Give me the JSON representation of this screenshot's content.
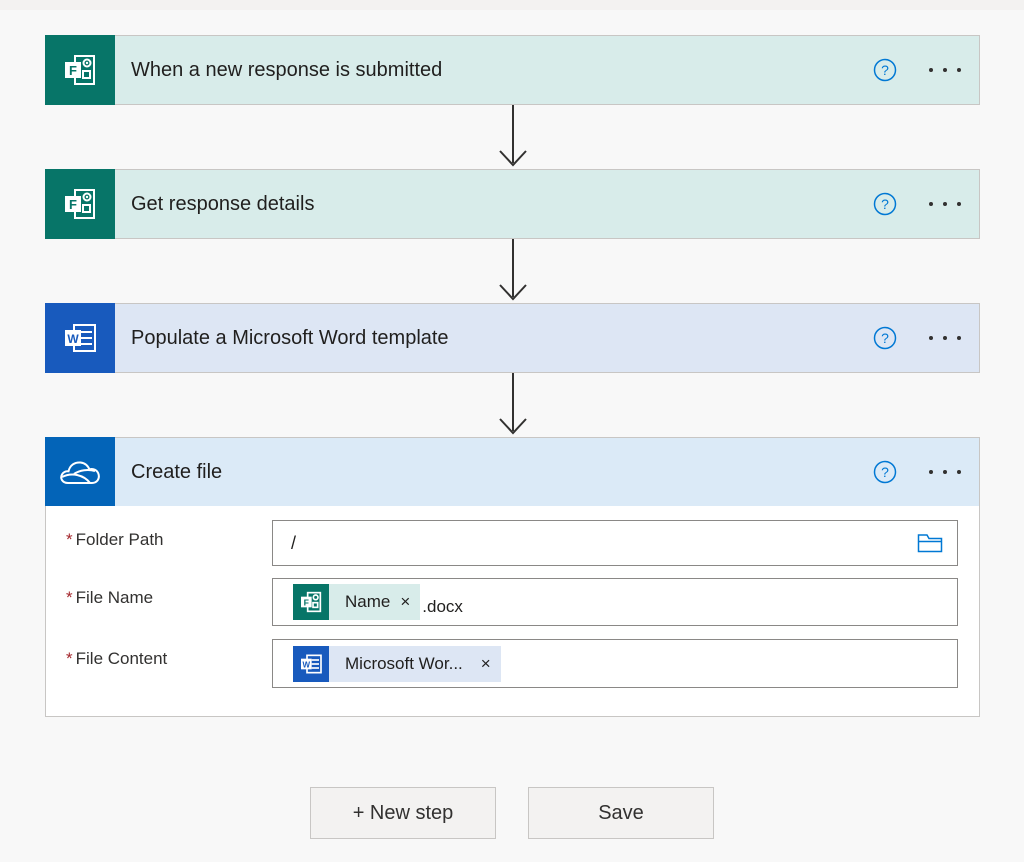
{
  "steps": [
    {
      "title": "When a new response is submitted",
      "icon": "forms-icon"
    },
    {
      "title": "Get response details",
      "icon": "forms-icon"
    },
    {
      "title": "Populate a Microsoft Word template",
      "icon": "word-icon"
    },
    {
      "title": "Create file",
      "icon": "onedrive-icon"
    }
  ],
  "create_file": {
    "folder_path": {
      "label": "Folder Path",
      "value": "/"
    },
    "file_name": {
      "label": "File Name",
      "token": "Name",
      "suffix": ".docx"
    },
    "file_content": {
      "label": "File Content",
      "token": "Microsoft Wor..."
    }
  },
  "required_marker": "*",
  "token_remove": "×",
  "buttons": {
    "new_step": "+ New step",
    "save": "Save"
  },
  "colors": {
    "forms_brand": "#077568",
    "word_brand": "#185abd",
    "onedrive_brand": "#0364b8",
    "link_blue": "#0078d4"
  }
}
